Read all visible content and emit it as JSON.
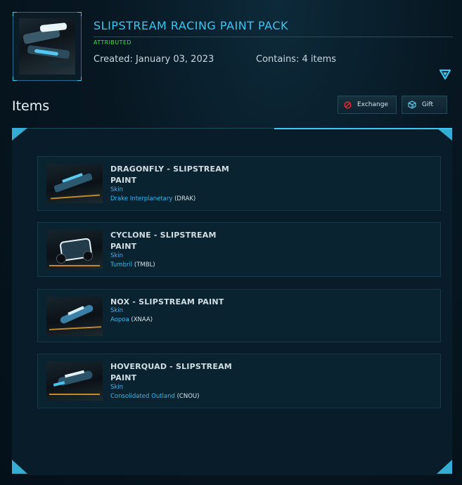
{
  "pack": {
    "title": "SLIPSTREAM RACING PAINT PACK",
    "status": "ATTRIBUTED",
    "created": "Created: January 03, 2023",
    "contains": "Contains: 4 items"
  },
  "section": {
    "title": "Items",
    "exchange_label": "Exchange",
    "gift_label": "Gift"
  },
  "items": [
    {
      "name_line1": "DRAGONFLY - SLIPSTREAM",
      "name_line2": "PAINT",
      "type": "Skin",
      "maker": "Drake Interplanetary",
      "code": "(DRAK)"
    },
    {
      "name_line1": "CYCLONE - SLIPSTREAM",
      "name_line2": "PAINT",
      "type": "Skin",
      "maker": "Tumbril",
      "code": "(TMBL)"
    },
    {
      "name_line1": "NOX - SLIPSTREAM PAINT",
      "name_line2": "",
      "type": "Skin",
      "maker": "Aopoa",
      "code": "(XNAA)"
    },
    {
      "name_line1": "HOVERQUAD - SLIPSTREAM",
      "name_line2": "PAINT",
      "type": "Skin",
      "maker": "Consolidated Outland",
      "code": "(CNOU)"
    }
  ],
  "colors": {
    "accent": "#38c6f4",
    "attributed": "#3ee04a",
    "exchange_icon": "#e0272b"
  },
  "icons": {
    "collapse": "triangle-down-icon",
    "exchange": "prohibited-icon",
    "gift": "cube-icon"
  }
}
